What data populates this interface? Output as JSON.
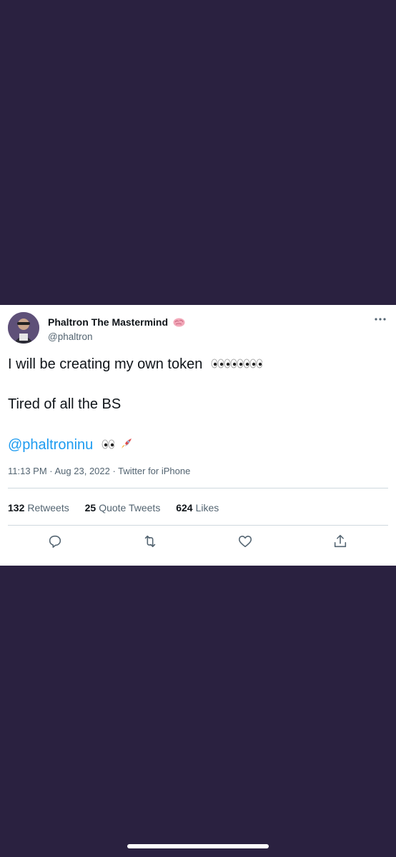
{
  "tweet": {
    "display_name": "Phaltron The Mastermind",
    "handle": "@phaltron",
    "line1": "I will be creating my own token",
    "line2": "Tired of all the BS",
    "mention": "@phaltroninu",
    "meta": "11:13 PM · Aug 23, 2022 · Twitter for iPhone",
    "stats": {
      "retweets_count": "132",
      "retweets_label": "Retweets",
      "quotes_count": "25",
      "quotes_label": "Quote Tweets",
      "likes_count": "624",
      "likes_label": "Likes"
    },
    "icons": {
      "name_emoji": "brain-icon",
      "line1_emoji": "eyes-icon x4",
      "mention_emoji": "eyes-icon, rocket-icon",
      "actions": [
        "reply-icon",
        "retweet-icon",
        "like-icon",
        "share-icon"
      ],
      "more": "more-options-icon"
    }
  },
  "colors": {
    "background": "#2a2140",
    "card": "#ffffff",
    "text": "#0f1419",
    "secondary": "#536471",
    "link": "#1d9bf0",
    "divider": "#cfd9de"
  }
}
